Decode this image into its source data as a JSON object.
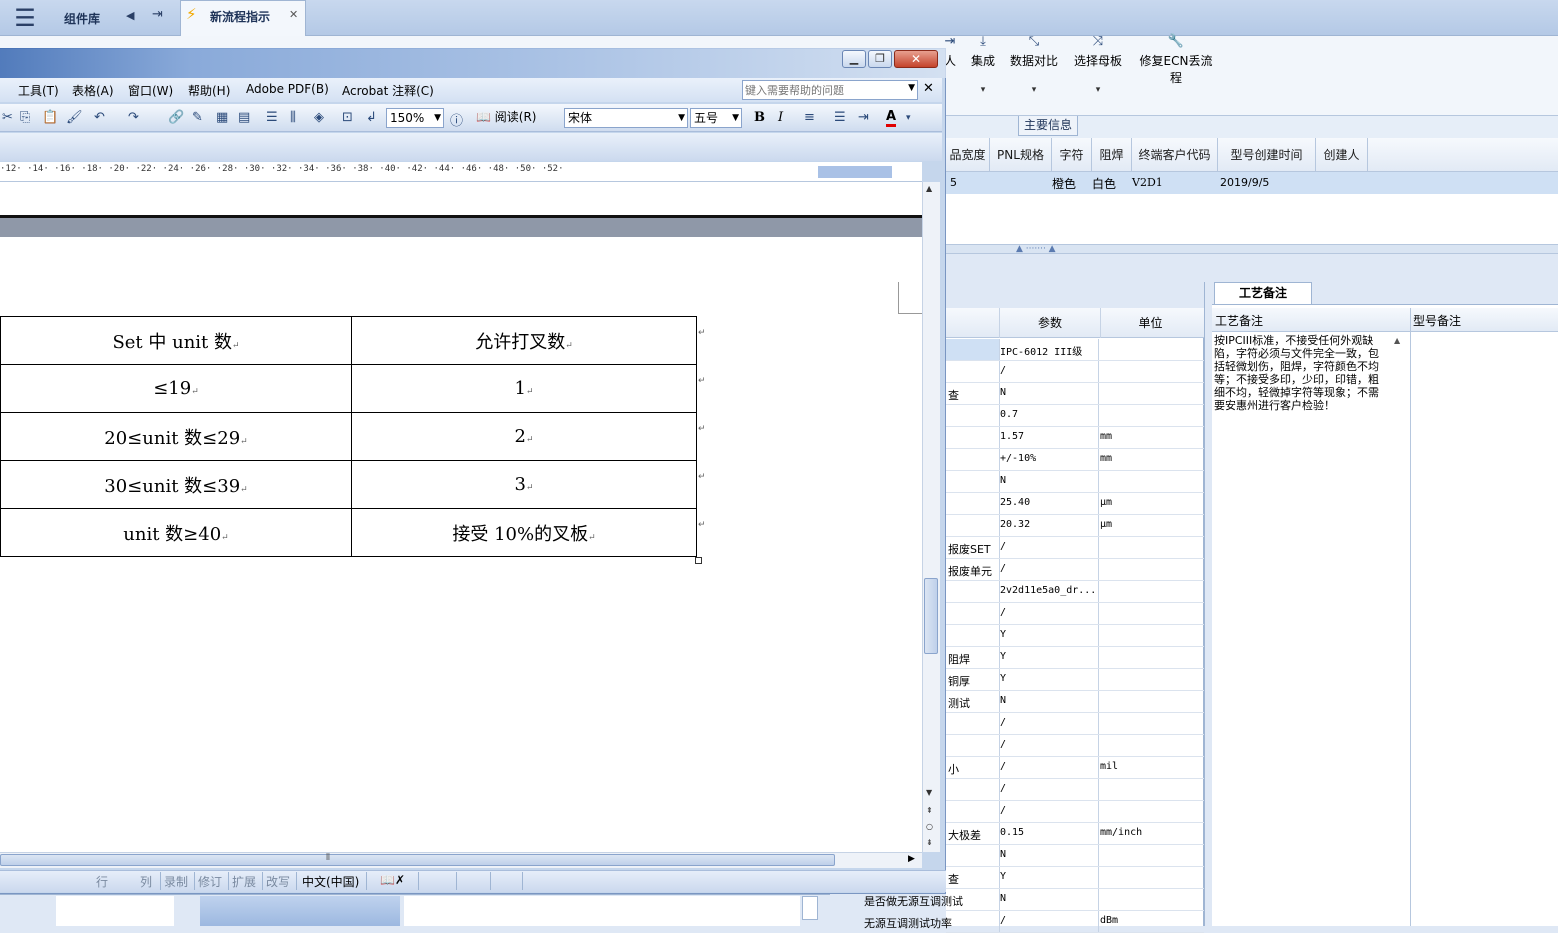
{
  "app": {
    "component_library": "组件库",
    "active_tab_title": "新流程指示"
  },
  "main_toolbar": {
    "buttons": [
      {
        "label": "集成",
        "icon": "download-icon"
      },
      {
        "label": "数据对比",
        "icon": "compress-icon"
      },
      {
        "label": "选择母板",
        "icon": "shuffle-icon"
      },
      {
        "label": "修复ECN丢流程",
        "icon": "wrench-icon"
      }
    ],
    "partial_label": "人",
    "main_info_tab": "主要信息"
  },
  "grid": {
    "columns": [
      "品宽度",
      "PNL规格",
      "字符",
      "阻焊",
      "终端客户代码",
      "型号创建时间",
      "创建人"
    ],
    "row": {
      "c0": "5",
      "char": "橙色",
      "mask": "白色",
      "client": "V2D1",
      "created": "2019/9/5",
      "creator": ""
    }
  },
  "param_panel": {
    "col_param": "参数",
    "col_unit": "单位",
    "rows": [
      {
        "name": "",
        "value": "IPC-6012 III级",
        "unit": ""
      },
      {
        "name": "",
        "value": "/",
        "unit": ""
      },
      {
        "name": "查",
        "value": "N",
        "unit": ""
      },
      {
        "name": "",
        "value": "0.7",
        "unit": ""
      },
      {
        "name": "",
        "value": "1.57",
        "unit": "mm"
      },
      {
        "name": "",
        "value": "+/-10%",
        "unit": "mm"
      },
      {
        "name": "",
        "value": "N",
        "unit": ""
      },
      {
        "name": "",
        "value": "25.40",
        "unit": "μm"
      },
      {
        "name": "",
        "value": "20.32",
        "unit": "μm"
      },
      {
        "name": "报废SET",
        "value": "/",
        "unit": ""
      },
      {
        "name": "报废单元",
        "value": "/",
        "unit": ""
      },
      {
        "name": "",
        "value": "2v2d11e5a0_dr...",
        "unit": ""
      },
      {
        "name": "",
        "value": "/",
        "unit": ""
      },
      {
        "name": "",
        "value": "Y",
        "unit": ""
      },
      {
        "name": "阻焊",
        "value": "Y",
        "unit": ""
      },
      {
        "name": "铜厚",
        "value": "Y",
        "unit": ""
      },
      {
        "name": "测试",
        "value": "N",
        "unit": ""
      },
      {
        "name": "",
        "value": "/",
        "unit": ""
      },
      {
        "name": "",
        "value": "/",
        "unit": ""
      },
      {
        "name": "小",
        "value": "/",
        "unit": "mil"
      },
      {
        "name": "",
        "value": "/",
        "unit": ""
      },
      {
        "name": "",
        "value": "/",
        "unit": ""
      },
      {
        "name": "大极差",
        "value": "0.15",
        "unit": "mm/inch"
      },
      {
        "name": "",
        "value": "N",
        "unit": ""
      },
      {
        "name": "查",
        "value": "Y",
        "unit": ""
      },
      {
        "name": "是否做无源互调测试",
        "value": "N",
        "unit": ""
      },
      {
        "name": "无源互调测试功率",
        "value": "/",
        "unit": "dBm"
      }
    ]
  },
  "craft_panel": {
    "tab": "工艺备注",
    "col_craft": "工艺备注",
    "col_model": "型号备注",
    "text": "按IPCIII标准，不接受任何外观缺陷，字符必须与文件完全一致，包括轻微划伤，阻焊，字符颜色不均等；不接受多印，少印，印错，粗细不均，轻微掉字符等现象；不需要安惠州进行客户检验！"
  },
  "word": {
    "menu": [
      "工具(T)",
      "表格(A)",
      "窗口(W)",
      "帮助(H)",
      "Adobe PDF(B)",
      "Acrobat 注释(C)"
    ],
    "help_placeholder": "键入需要帮助的问题",
    "zoom": "150%",
    "read_label": "阅读(R)",
    "font_name": "宋体",
    "font_size": "五号",
    "bold": "B",
    "italic": "I",
    "font_color_label": "A",
    "ruler": "·12· ·14· ·16· ·18· ·20· ·22· ·24· ·26· ·28· ·30· ·32· ·34· ·36· ·38· ·40· ·42· ·44· ·46· ·48· ·50· ·52·",
    "table": [
      [
        "Set 中 unit 数",
        "允许打叉数"
      ],
      [
        "≤19",
        "1"
      ],
      [
        "20≤unit 数≤29",
        "2"
      ],
      [
        "30≤unit 数≤39",
        "3"
      ],
      [
        "unit 数≥40",
        "接受 10%的叉板"
      ]
    ],
    "paragraph_mark": "↵",
    "status": {
      "line": "行",
      "col": "列",
      "rec": "录制",
      "trk": "修订",
      "ext": "扩展",
      "ovr": "改写",
      "lang": "中文(中国)"
    }
  },
  "colors": {
    "accent": "#2b4a7a",
    "close_red": "#c4432b",
    "selection": "#cfe0f4"
  }
}
